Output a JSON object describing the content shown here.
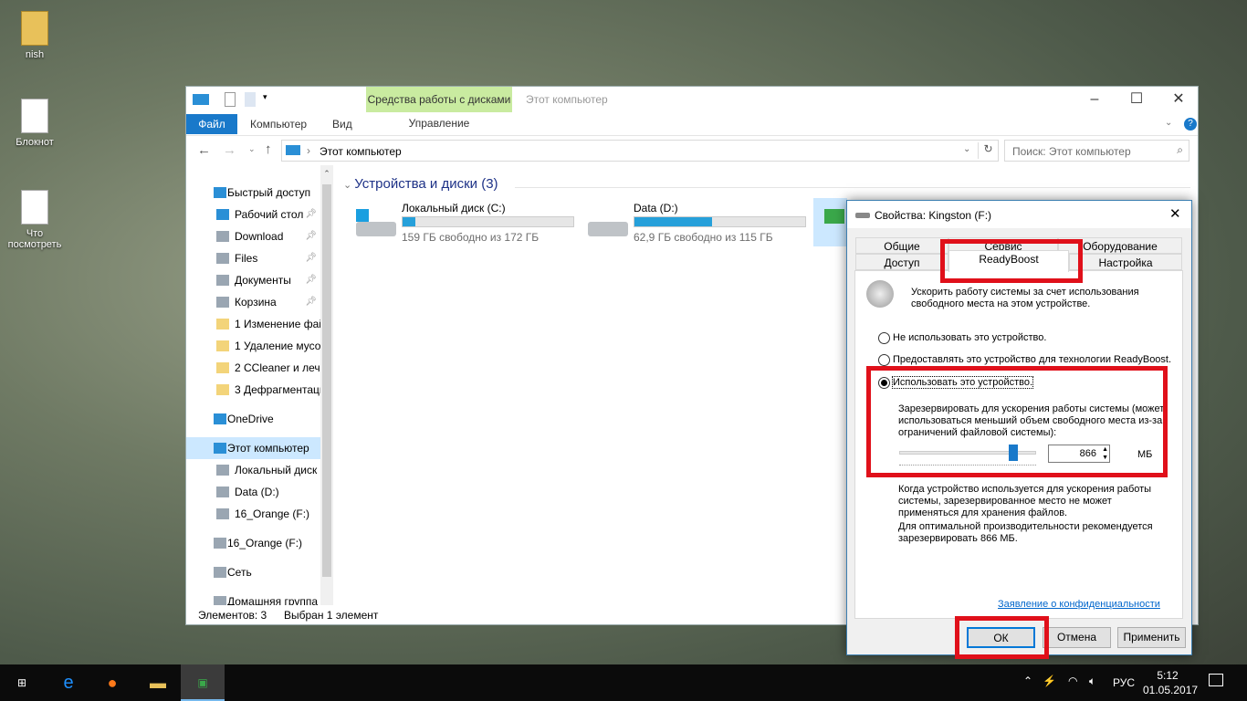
{
  "desktop": {
    "icons": [
      {
        "label": "nish"
      },
      {
        "label": "Блокнот"
      },
      {
        "label": "Что посмотреть"
      }
    ]
  },
  "explorer": {
    "ribbon": {
      "context_group": "Средства работы с дисками",
      "title": "Этот компьютер",
      "tabs": [
        "Файл",
        "Компьютер",
        "Вид",
        "Управление"
      ]
    },
    "address": {
      "path": "Этот компьютер",
      "search_placeholder": "Поиск: Этот компьютер"
    },
    "nav": [
      {
        "label": "Быстрый доступ",
        "icon": "star-icon"
      },
      {
        "label": "Рабочий стол",
        "icon": "desktop-icon",
        "pinned": true
      },
      {
        "label": "Download",
        "icon": "download-folder-icon",
        "pinned": true
      },
      {
        "label": "Files",
        "icon": "files-icon",
        "pinned": true
      },
      {
        "label": "Документы",
        "icon": "documents-icon",
        "pinned": true
      },
      {
        "label": "Корзина",
        "icon": "recycle-bin-icon",
        "pinned": true
      },
      {
        "label": "1 Изменение фай",
        "icon": "folder-icon"
      },
      {
        "label": "1 Удаление мусо",
        "icon": "folder-icon"
      },
      {
        "label": "2 CCleaner и лечє",
        "icon": "folder-icon"
      },
      {
        "label": "3 Дефрагментаци",
        "icon": "folder-icon"
      },
      {
        "label": "OneDrive",
        "icon": "cloud-icon"
      },
      {
        "label": "Этот компьютер",
        "icon": "computer-icon"
      },
      {
        "label": "Локальный диск",
        "icon": "drive-icon"
      },
      {
        "label": "Data (D:)",
        "icon": "drive-icon"
      },
      {
        "label": "16_Orange (F:)",
        "icon": "usb-drive-icon"
      },
      {
        "label": "16_Orange (F:)",
        "icon": "usb-drive-icon"
      },
      {
        "label": "Сеть",
        "icon": "network-icon"
      },
      {
        "label": "Домашняя группа",
        "icon": "homegroup-icon"
      }
    ],
    "section_title": "Устройства и диски (3)",
    "drives": [
      {
        "name": "Локальный диск (C:)",
        "free": "159 ГБ свободно из 172 ГБ",
        "used_fraction": 0.076
      },
      {
        "name": "Data (D:)",
        "free": "62,9 ГБ свободно из 115 ГБ",
        "used_fraction": 0.453
      }
    ],
    "status": {
      "count": "Элементов: 3",
      "selected": "Выбран 1 элемент"
    }
  },
  "dialog": {
    "title": "Свойства: Kingston (F:)",
    "tabs_row1": [
      "Общие",
      "Сервис",
      "Оборудование"
    ],
    "tabs_row2": [
      "Доступ",
      "ReadyBoost",
      "Настройка"
    ],
    "intro": "Ускорить работу системы за счет использования свободного места на этом устройстве.",
    "options": [
      "Не использовать это устройство.",
      "Предоставлять это устройство для технологии ReadyBoost.",
      "Использовать это устройство."
    ],
    "selected_option": 2,
    "reserve_label": "Зарезервировать для ускорения работы системы (может использоваться меньший объем свободного места из-за ограничений файловой системы):",
    "reserve_value": "866",
    "unit": "МБ",
    "slider_fraction": 0.85,
    "note1": "Когда устройство используется для ускорения работы системы, зарезервированное место не может применяться для хранения файлов.",
    "note2": "Для оптимальной производительности рекомендуется зарезервировать 866 МБ.",
    "privacy_link": "Заявление о конфиденциальности",
    "buttons": {
      "ok": "ОК",
      "cancel": "Отмена",
      "apply": "Применить"
    }
  },
  "taskbar": {
    "lang": "РУС",
    "time": "5:12",
    "date": "01.05.2017"
  }
}
